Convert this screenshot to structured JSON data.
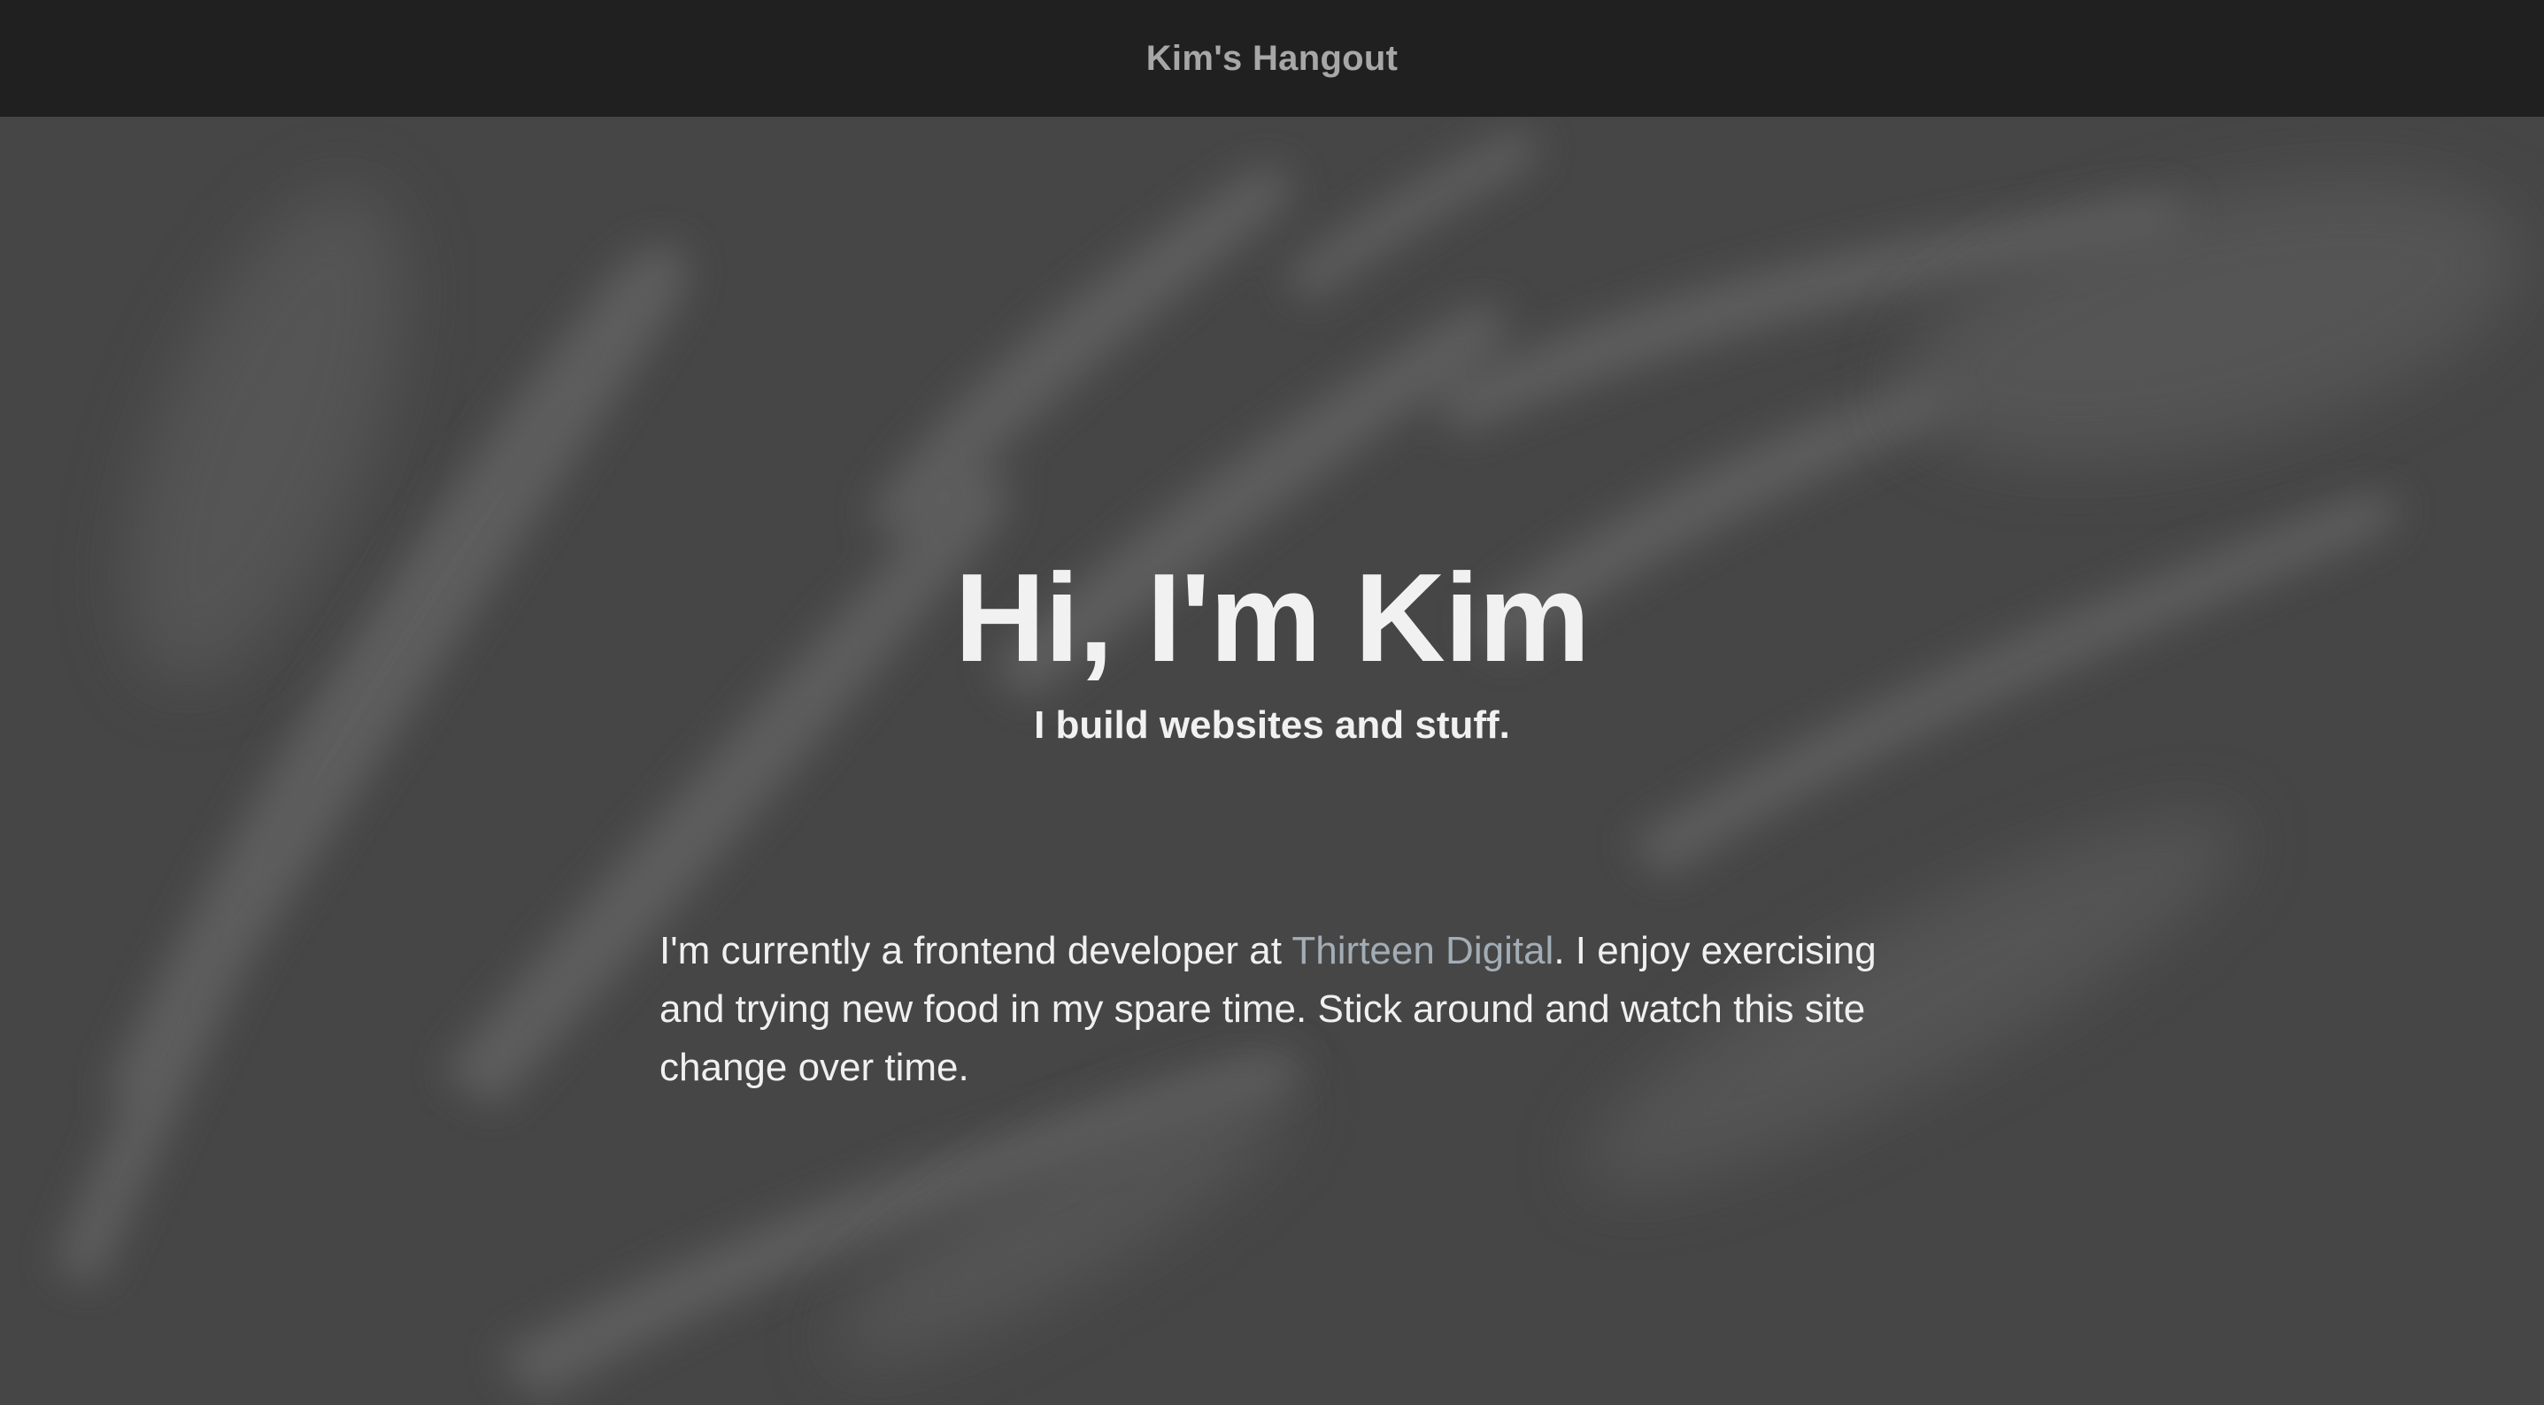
{
  "site": {
    "title": "Kim's Hangout"
  },
  "hero": {
    "headline": "Hi, I'm Kim",
    "tagline": "I build websites and stuff.",
    "bio": {
      "before_link": "I'm currently a frontend developer at ",
      "link_text": "Thirteen Digital",
      "after_link": ". I enjoy exercising and trying new food in my spare time. Stick around and watch this site change over time."
    }
  },
  "colors": {
    "nav_background": "#202020",
    "nav_title": "#a7a7a7",
    "hero_background": "#464646",
    "text": "#f1f1f1",
    "link": "#a3adb6"
  }
}
